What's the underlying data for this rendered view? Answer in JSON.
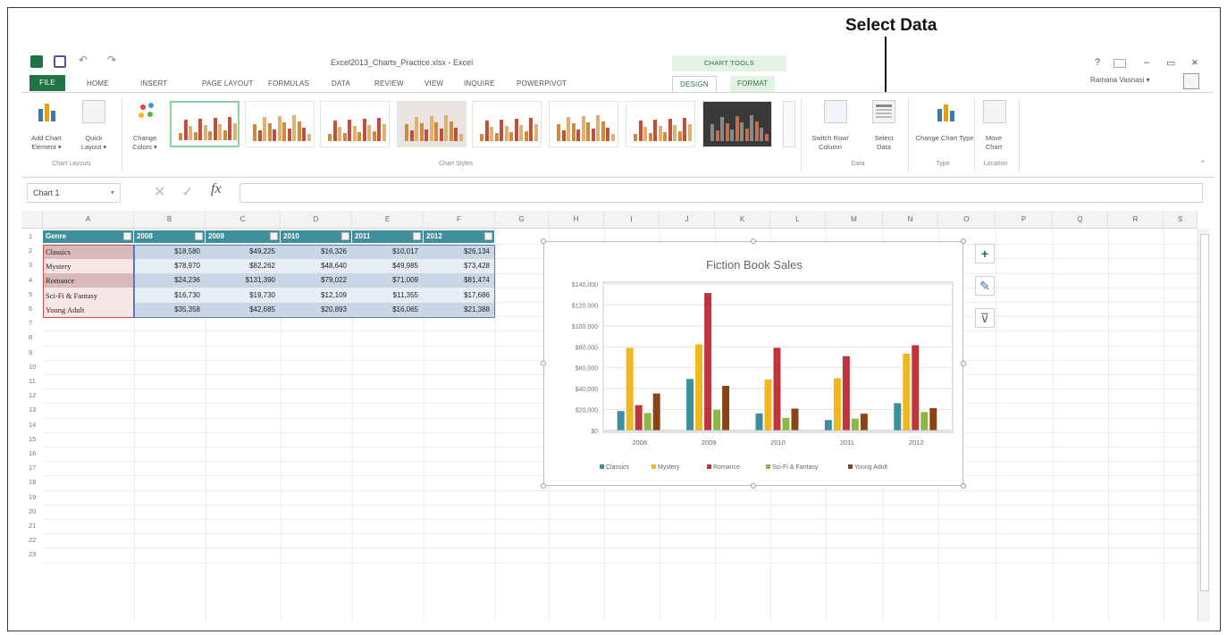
{
  "callout": {
    "label": "Select Data"
  },
  "window": {
    "doc_title": "Excel2013_Charts_Practice.xlsx - Excel",
    "chart_tools": "CHART TOOLS",
    "help": "?",
    "minimize": "–",
    "restore": "▭",
    "close": "×",
    "user": "Ramana Vasnasi",
    "user_caret": "▾"
  },
  "tabs": {
    "file": "FILE",
    "home": "HOME",
    "insert": "INSERT",
    "page_layout": "PAGE LAYOUT",
    "formulas": "FORMULAS",
    "data": "DATA",
    "review": "REVIEW",
    "view": "VIEW",
    "inquire": "INQUIRE",
    "powerpivot": "POWERPIVOT",
    "design": "DESIGN",
    "format": "FORMAT"
  },
  "ribbon": {
    "add_chart_element": "Add Chart Element ▾",
    "quick_layout": "Quick Layout ▾",
    "change_colors": "Change Colors ▾",
    "switch_row_column": "Switch Row/ Column",
    "select_data": "Select Data",
    "change_chart_type": "Change Chart Type",
    "move_chart": "Move Chart",
    "groups": {
      "chart_layouts": "Chart Layouts",
      "chart_styles": "Chart Styles",
      "data": "Data",
      "type": "Type",
      "location": "Location"
    }
  },
  "formula_bar": {
    "name_box": "Chart 1",
    "fx": "fx",
    "cancel": "✕",
    "enter": "✓"
  },
  "columns": [
    "A",
    "B",
    "C",
    "D",
    "E",
    "F",
    "G",
    "H",
    "I",
    "J",
    "K",
    "L",
    "M",
    "N",
    "O",
    "P",
    "Q",
    "R",
    "S"
  ],
  "rows": [
    "1",
    "2",
    "3",
    "4",
    "5",
    "6",
    "7",
    "8",
    "9",
    "10",
    "11",
    "12",
    "13",
    "14",
    "15",
    "16",
    "17",
    "18",
    "19",
    "20",
    "21",
    "22",
    "23"
  ],
  "table": {
    "headers": [
      "Genre",
      "2008",
      "2009",
      "2010",
      "2011",
      "2012"
    ],
    "rows": [
      {
        "genre": "Classics",
        "values": [
          "$18,580",
          "$49,225",
          "$16,326",
          "$10,017",
          "$26,134"
        ]
      },
      {
        "genre": "Mystery",
        "values": [
          "$78,970",
          "$82,262",
          "$48,640",
          "$49,985",
          "$73,428"
        ]
      },
      {
        "genre": "Romance",
        "values": [
          "$24,236",
          "$131,390",
          "$79,022",
          "$71,009",
          "$81,474"
        ]
      },
      {
        "genre": "Sci-Fi & Fantasy",
        "values": [
          "$16,730",
          "$19,730",
          "$12,109",
          "$11,355",
          "$17,686"
        ]
      },
      {
        "genre": "Young Adult",
        "values": [
          "$35,358",
          "$42,685",
          "$20,893",
          "$16,065",
          "$21,388"
        ]
      }
    ]
  },
  "side_buttons": {
    "elements": "+",
    "styles": "✎",
    "filter": "⊽"
  },
  "chart_data": {
    "type": "bar",
    "title": "Fiction Book Sales",
    "categories": [
      "2008",
      "2009",
      "2010",
      "2011",
      "2012"
    ],
    "y_ticks": [
      "$0",
      "$20,000",
      "$40,000",
      "$60,000",
      "$80,000",
      "$100,000",
      "$120,000",
      "$140,000"
    ],
    "ylim": [
      0,
      140000
    ],
    "grid": true,
    "legend_position": "bottom",
    "series": [
      {
        "name": "Classics",
        "color": "#3a8fa0",
        "values": [
          18580,
          49225,
          16326,
          10017,
          26134
        ]
      },
      {
        "name": "Mystery",
        "color": "#f0b81e",
        "values": [
          78970,
          82262,
          48640,
          49985,
          73428
        ]
      },
      {
        "name": "Romance",
        "color": "#c0343c",
        "values": [
          24236,
          131390,
          79022,
          71009,
          81474
        ]
      },
      {
        "name": "Sci-Fi & Fantasy",
        "color": "#8db843",
        "values": [
          16730,
          19730,
          12109,
          11355,
          17686
        ]
      },
      {
        "name": "Young Adult",
        "color": "#8a4416",
        "values": [
          35358,
          42685,
          20893,
          16065,
          21388
        ]
      }
    ]
  }
}
